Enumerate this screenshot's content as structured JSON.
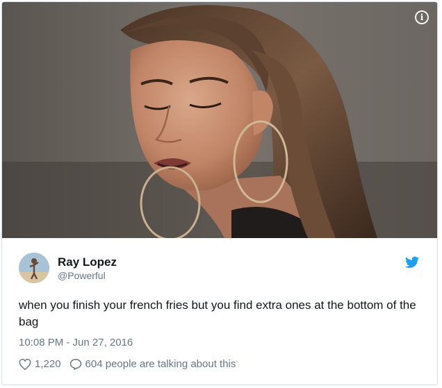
{
  "tweet": {
    "author_name": "Ray Lopez",
    "author_handle": "@Powerful",
    "text": "when you finish your french fries but you find extra ones at the bottom of the bag",
    "timestamp": "10:08 PM - Jun 27, 2016",
    "likes": "1,220",
    "replies_text": "604 people are talking about this"
  },
  "icons": {
    "info": "info-icon",
    "bird": "twitter-bird-icon",
    "like": "heart-icon",
    "reply": "speech-bubble-icon"
  },
  "colors": {
    "twitter_blue": "#1da1f2",
    "secondary_text": "#657786",
    "primary_text": "#14171a"
  }
}
